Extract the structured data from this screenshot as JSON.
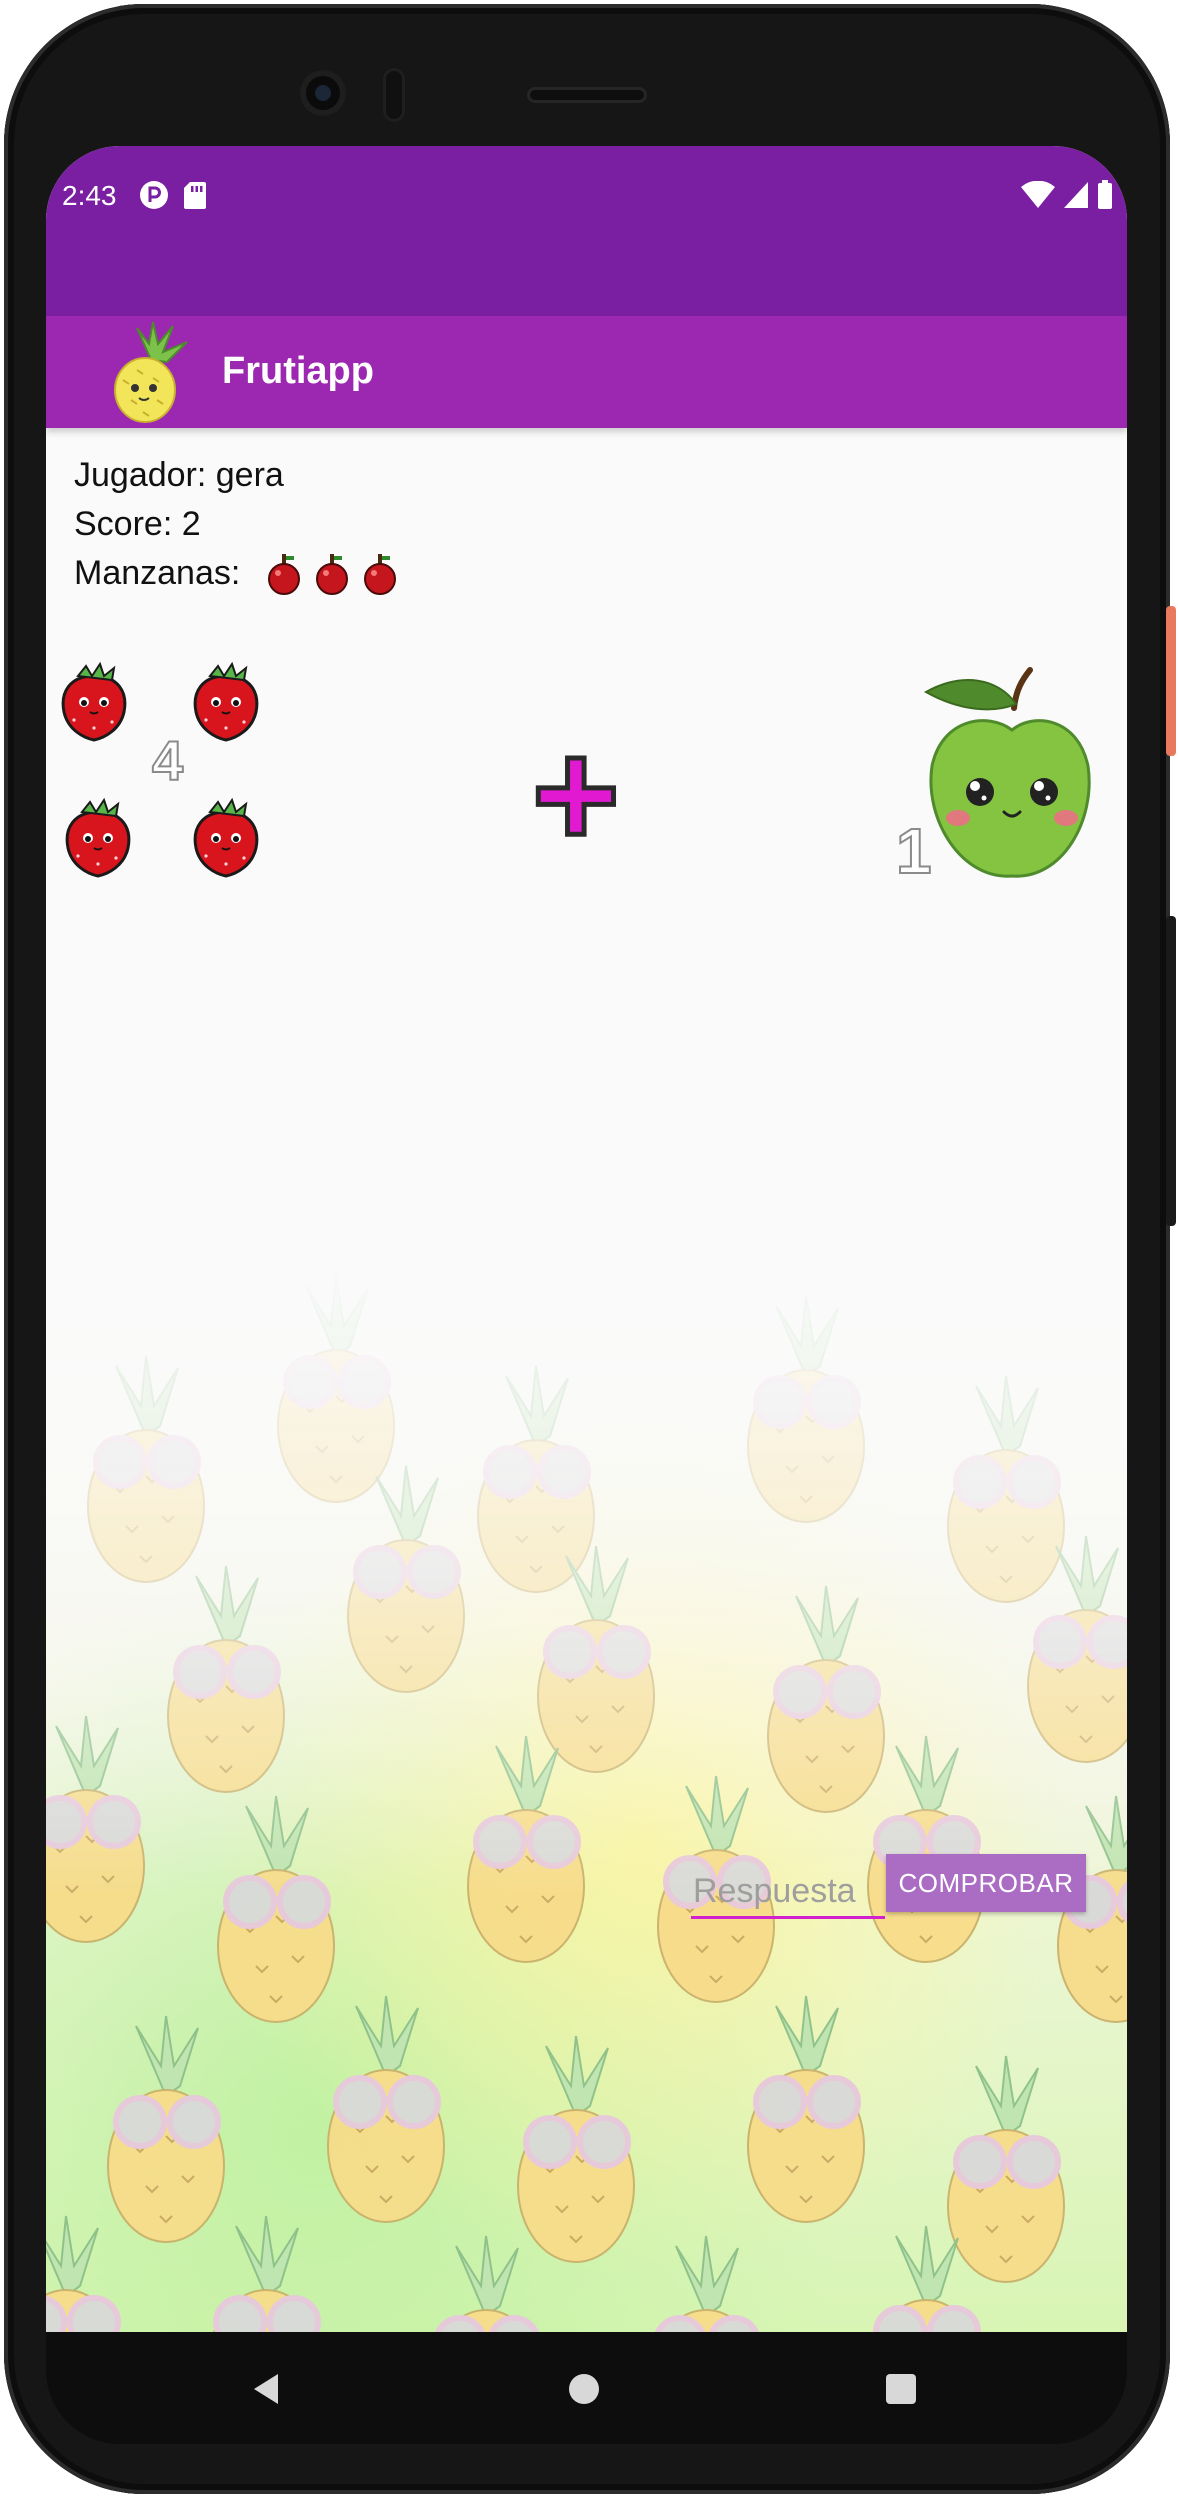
{
  "status_bar": {
    "time": "2:43",
    "left_icons": [
      "p-icon",
      "sd-card-icon"
    ],
    "right_icons": [
      "wifi-icon",
      "signal-icon",
      "battery-icon"
    ]
  },
  "app_bar": {
    "title": "Frutiapp",
    "logo_icon": "pineapple-icon"
  },
  "game": {
    "player_label": "Jugador: gera",
    "score_label": "Score: 2",
    "lives_label": "Manzanas:",
    "lives": 3,
    "left_number": "4",
    "left_fruit_icon": "strawberry-icon",
    "left_fruit_count": 4,
    "operator": "+",
    "right_number": "1",
    "right_fruit_icon": "green-apple-icon",
    "right_fruit_count": 1
  },
  "answer": {
    "placeholder": "Respuesta",
    "value": ""
  },
  "check_button": {
    "label": "COMPROBAR"
  },
  "nav_bar": {
    "icons": [
      "back-icon",
      "home-icon",
      "recents-icon"
    ]
  },
  "colors": {
    "status_bar": "#7b1fa2",
    "app_bar": "#9c27b0",
    "accent": "#d21fd0",
    "button": "#ab6dc4",
    "operator": "#e11ad2"
  }
}
